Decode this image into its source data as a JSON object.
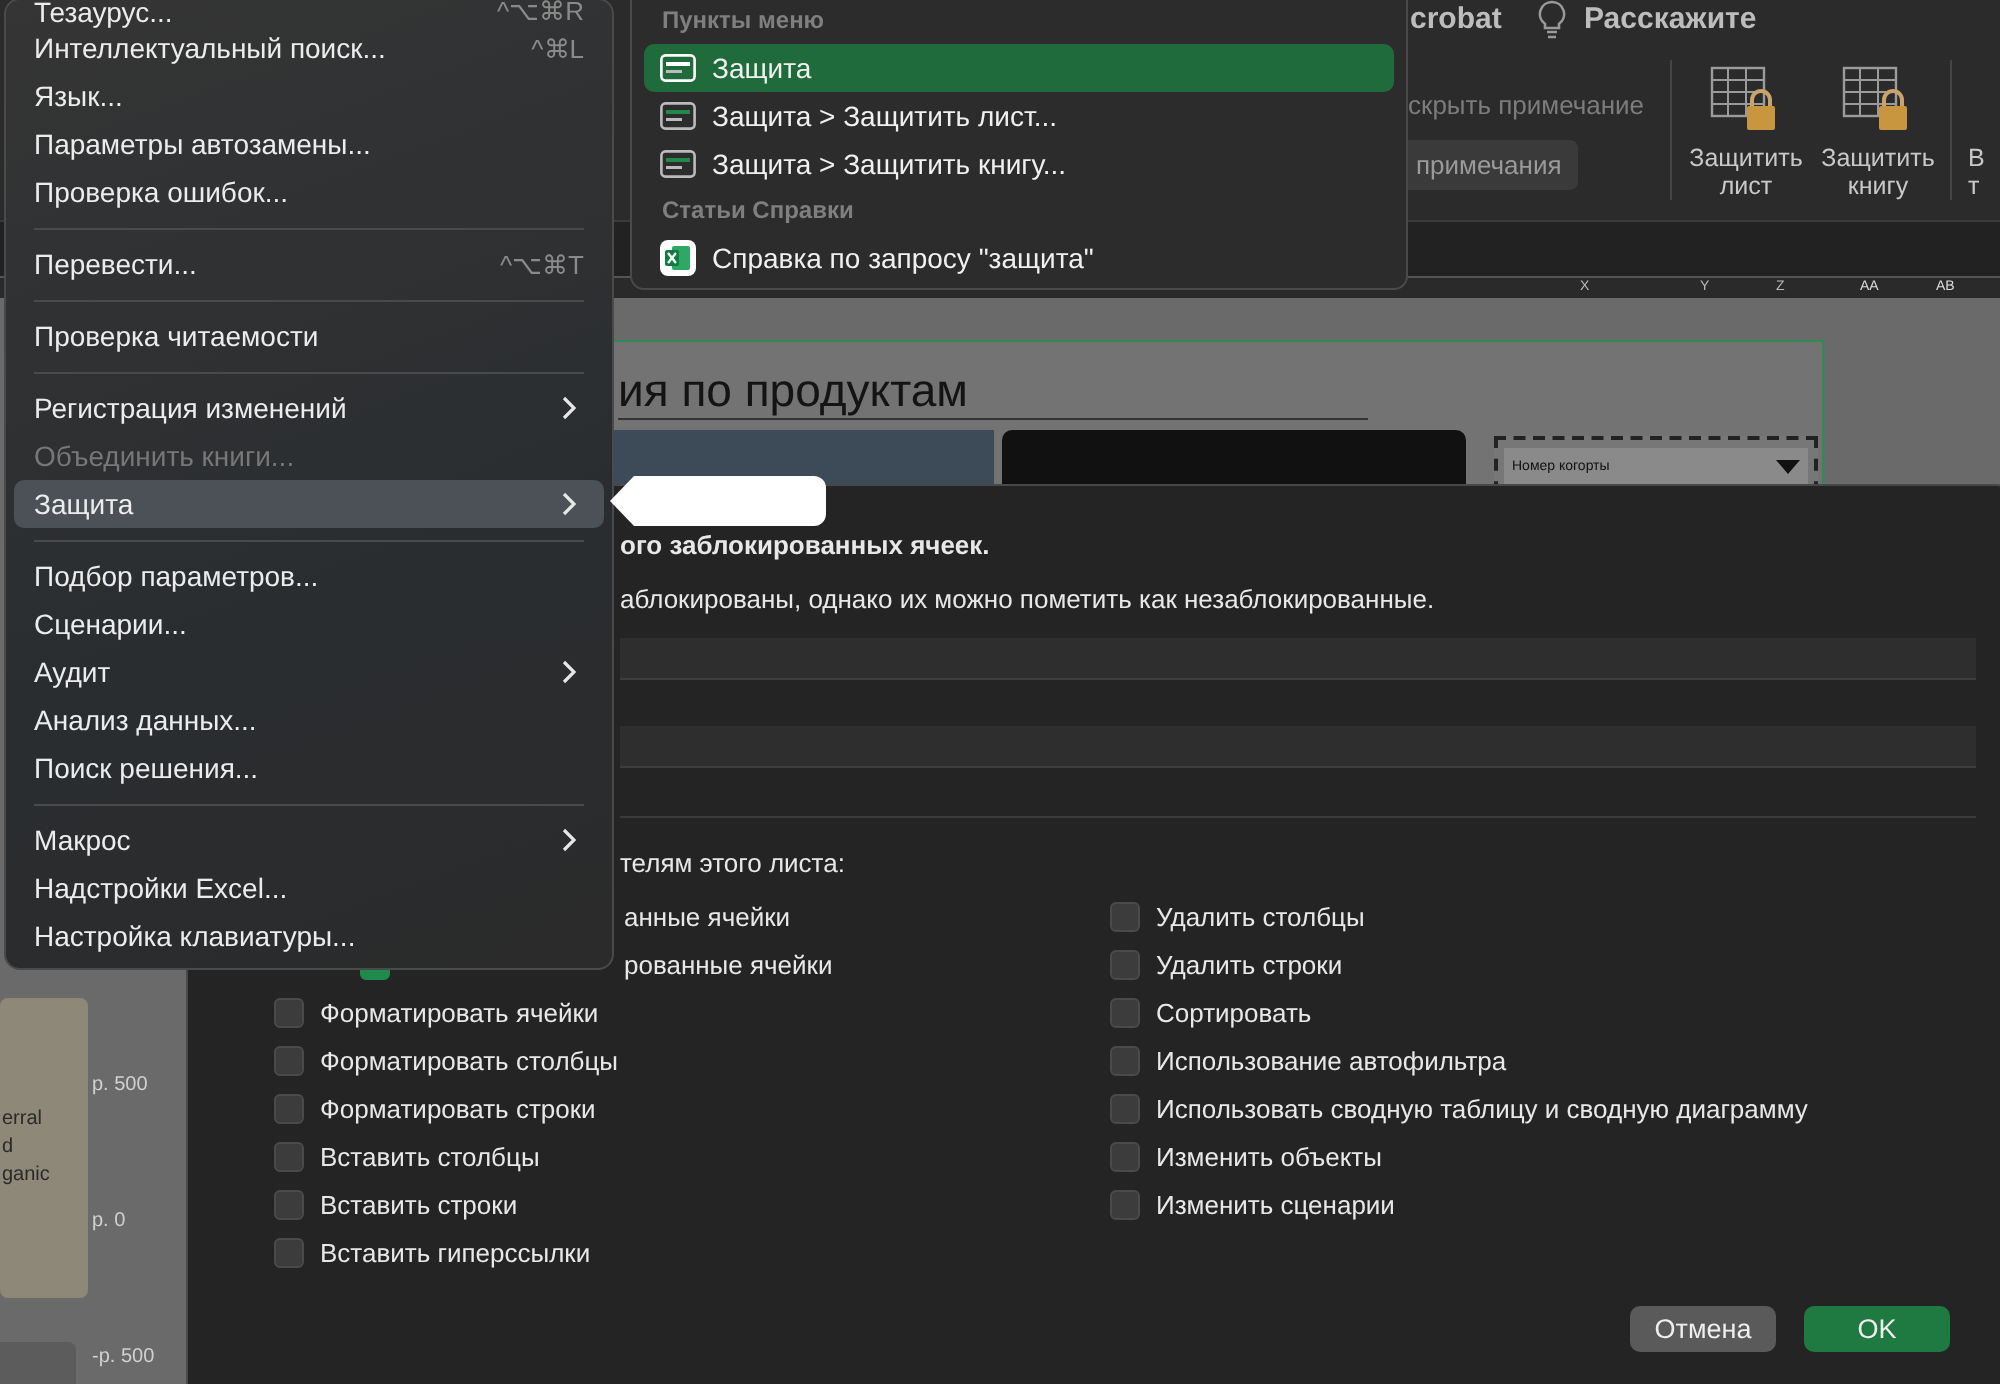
{
  "ribbon": {
    "tab_fragment": "crobat",
    "tell_me": "Расскажите",
    "hide_comment": {
      "label": "скрыть примечание",
      "disabled": true
    },
    "comments_button": "примечания",
    "protect_buttons": [
      {
        "kind": "protect",
        "lines": [
          "Защитить",
          "лист"
        ]
      },
      {
        "kind": "protect",
        "lines": [
          "Защитить",
          "книгу"
        ]
      },
      {
        "kind": "partial",
        "lines": [
          "В",
          "т"
        ]
      }
    ]
  },
  "columns": [
    "X",
    "Y",
    "Z",
    "AA",
    "AB"
  ],
  "sheet": {
    "title": "ия по продуктам",
    "filter": "Номер когорты",
    "card_lines": [
      "erral",
      "d",
      "ganic"
    ],
    "axis_labels": [
      "р. 500",
      "р. 0",
      "-р. 500"
    ]
  },
  "dialog": {
    "heading": "ого заблокированных ячеек.",
    "note": "аблокированы, однако их можно пометить как незаблокированные.",
    "allow_label": "телям этого листа:",
    "options_left": [
      {
        "kind": "partial",
        "label": "анные ячейки"
      },
      {
        "kind": "partial",
        "label": "рованные ячейки",
        "checked": true
      },
      {
        "kind": "full",
        "label": "Форматировать ячейки",
        "checked": false
      },
      {
        "kind": "full",
        "label": "Форматировать столбцы",
        "checked": false
      },
      {
        "kind": "full",
        "label": "Форматировать строки",
        "checked": false
      },
      {
        "kind": "full",
        "label": "Вставить столбцы",
        "checked": false
      },
      {
        "kind": "full",
        "label": "Вставить строки",
        "checked": false
      },
      {
        "kind": "full",
        "label": "Вставить гиперссылки",
        "checked": false
      }
    ],
    "options_right": [
      {
        "label": "Удалить столбцы",
        "checked": false
      },
      {
        "label": "Удалить строки",
        "checked": false
      },
      {
        "label": "Сортировать",
        "checked": false
      },
      {
        "label": "Использование автофильтра",
        "checked": false
      },
      {
        "label": "Использовать сводную таблицу и сводную диаграмму",
        "checked": false
      },
      {
        "label": "Изменить объекты",
        "checked": false
      },
      {
        "label": "Изменить сценарии",
        "checked": false
      }
    ],
    "cancel": "Отмена",
    "ok": "OK"
  },
  "tools_menu": [
    {
      "kind": "item",
      "label": "Тезаурус...",
      "shortcut": "^⌥⌘R",
      "submenu": false,
      "disabled": false,
      "selected": false
    },
    {
      "kind": "item",
      "label": "Интеллектуальный поиск...",
      "shortcut": "^⌘L",
      "submenu": false,
      "disabled": false,
      "selected": false
    },
    {
      "kind": "item",
      "label": "Язык...",
      "submenu": false,
      "disabled": false,
      "selected": false
    },
    {
      "kind": "item",
      "label": "Параметры автозамены...",
      "submenu": false,
      "disabled": false,
      "selected": false
    },
    {
      "kind": "item",
      "label": "Проверка ошибок...",
      "submenu": false,
      "disabled": false,
      "selected": false
    },
    {
      "kind": "separator"
    },
    {
      "kind": "item",
      "label": "Перевести...",
      "shortcut": "^⌥⌘T",
      "submenu": false,
      "disabled": false,
      "selected": false
    },
    {
      "kind": "separator"
    },
    {
      "kind": "item",
      "label": "Проверка читаемости",
      "submenu": false,
      "disabled": false,
      "selected": false
    },
    {
      "kind": "separator"
    },
    {
      "kind": "item",
      "label": "Регистрация изменений",
      "submenu": true,
      "disabled": false,
      "selected": false
    },
    {
      "kind": "item",
      "label": "Объединить книги...",
      "submenu": false,
      "disabled": true,
      "selected": false
    },
    {
      "kind": "item",
      "label": "Защита",
      "submenu": true,
      "disabled": false,
      "selected": true
    },
    {
      "kind": "separator"
    },
    {
      "kind": "item",
      "label": "Подбор параметров...",
      "submenu": false,
      "disabled": false,
      "selected": false
    },
    {
      "kind": "item",
      "label": "Сценарии...",
      "submenu": false,
      "disabled": false,
      "selected": false
    },
    {
      "kind": "item",
      "label": "Аудит",
      "submenu": true,
      "disabled": false,
      "selected": false
    },
    {
      "kind": "item",
      "label": "Анализ данных...",
      "submenu": false,
      "disabled": false,
      "selected": false
    },
    {
      "kind": "item",
      "label": "Поиск решения...",
      "submenu": false,
      "disabled": false,
      "selected": false
    },
    {
      "kind": "separator"
    },
    {
      "kind": "item",
      "label": "Макрос",
      "submenu": true,
      "disabled": false,
      "selected": false
    },
    {
      "kind": "item",
      "label": "Надстройки Excel...",
      "submenu": false,
      "disabled": false,
      "selected": false
    },
    {
      "kind": "item",
      "label": "Настройка клавиатуры...",
      "submenu": false,
      "disabled": false,
      "selected": false
    }
  ],
  "search_popup": {
    "sections": [
      {
        "header": "Пункты меню",
        "items": [
          {
            "kind": "menu",
            "label": "Защита",
            "selected": true
          },
          {
            "kind": "menu",
            "label": "Защита > Защитить лист...",
            "selected": false
          },
          {
            "kind": "menu",
            "label": "Защита > Защитить книгу...",
            "selected": false
          }
        ]
      },
      {
        "header": "Статьи Справки",
        "items": [
          {
            "kind": "help",
            "label": "Справка по запросу \"защита\"",
            "selected": false
          }
        ]
      }
    ]
  }
}
